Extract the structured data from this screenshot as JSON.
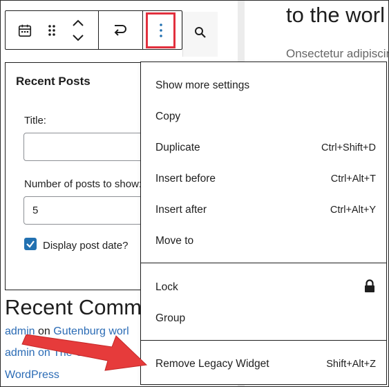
{
  "post": {
    "heading": "to the worl",
    "paragraph": "Onsectetur adipiscin"
  },
  "toolbar": {
    "calendar_icon": "calendar-icon",
    "drag_icon": "drag-handle-icon",
    "move_icon": "move-up-down-icon",
    "transform_icon": "transform-icon",
    "options_icon": "more-vertical-icon",
    "search_icon": "search-icon"
  },
  "widget": {
    "title": "Recent Posts",
    "title_label": "Title:",
    "title_value": "",
    "number_label": "Number of posts to show:",
    "number_value": "5",
    "display_date_label": "Display post date?",
    "display_date_checked": true
  },
  "recent_comments": {
    "heading": "Recent Comments",
    "line1_author": "admin",
    "line1_on": " on ",
    "line1_post": "Gutenburg worl",
    "line2_author": "admin",
    "line2_rest": " on The Clas Ga",
    "line3": "WordPress"
  },
  "menu": {
    "groups": [
      [
        {
          "label": "Show more settings",
          "shortcut": ""
        },
        {
          "label": "Copy",
          "shortcut": ""
        },
        {
          "label": "Duplicate",
          "shortcut": "Ctrl+Shift+D"
        },
        {
          "label": "Insert before",
          "shortcut": "Ctrl+Alt+T"
        },
        {
          "label": "Insert after",
          "shortcut": "Ctrl+Alt+Y"
        },
        {
          "label": "Move to",
          "shortcut": ""
        }
      ],
      [
        {
          "label": "Lock",
          "shortcut": "",
          "icon": "lock-icon"
        },
        {
          "label": "Group",
          "shortcut": ""
        }
      ],
      [
        {
          "label": "Remove Legacy Widget",
          "shortcut": "Shift+Alt+Z"
        }
      ]
    ]
  },
  "colors": {
    "highlight": "#e2303e",
    "arrow": "#e63b3b",
    "link": "#2a6bb5",
    "accent": "#2271b1"
  }
}
